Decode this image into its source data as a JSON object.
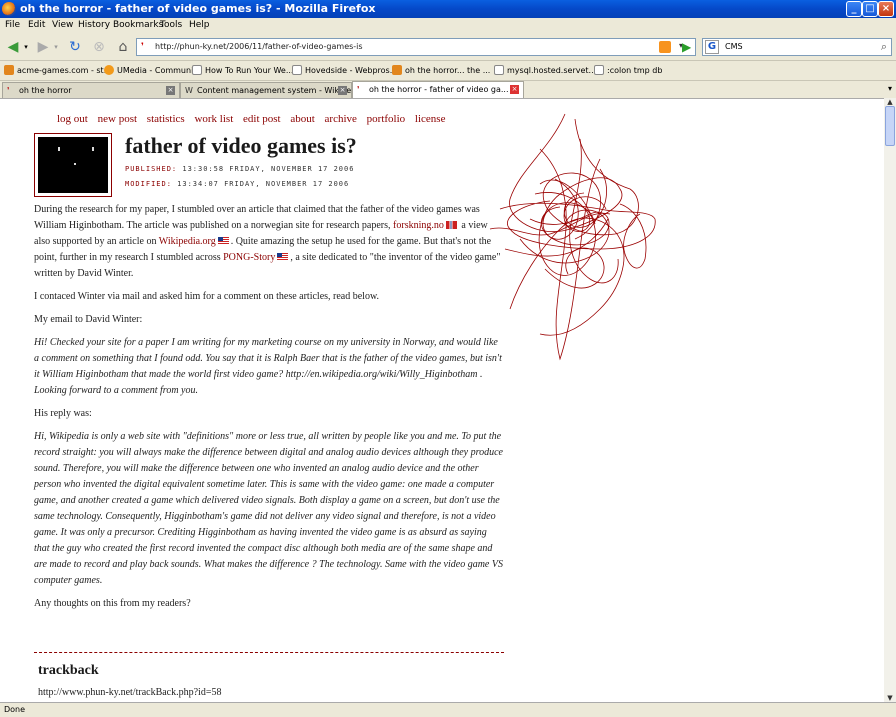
{
  "window": {
    "title": "oh the horror - father of video games is? - Mozilla Firefox"
  },
  "menu": [
    "File",
    "Edit",
    "View",
    "History",
    "Bookmarks",
    "Tools",
    "Help"
  ],
  "navbar": {
    "url": "http://phun-ky.net/2006/11/father-of-video-games-is",
    "search_value": "CMS"
  },
  "bookmarks": [
    {
      "label": "acme-games.com - st..."
    },
    {
      "label": "UMedia - Community"
    },
    {
      "label": "How To Run Your We..."
    },
    {
      "label": "Hovedside - Webpros..."
    },
    {
      "label": "oh the horror... the ..."
    },
    {
      "label": "mysql.hosted.servet..."
    },
    {
      "label": ":colon tmp db"
    }
  ],
  "tabs": [
    {
      "label": "oh the horror"
    },
    {
      "label": "Content management system - Wikipe..."
    },
    {
      "label": "oh the horror - father of video ga..."
    }
  ],
  "page": {
    "nav": [
      "log out",
      "new post",
      "statistics",
      "work list",
      "edit post",
      "about",
      "archive",
      "portfolio",
      "license"
    ],
    "title": "father of video games is?",
    "published_label": "PUBLISHED:",
    "published_value": "13:30:58 FRIDAY, NOVEMBER 17 2006",
    "modified_label": "MODIFIED:",
    "modified_value": "13:34:07 FRIDAY, NOVEMBER 17 2006",
    "p1_a": "During the research for my paper, I stumbled over an article that claimed that the father of the video games was William Higinbotham. The article was published on a norwegian site for research papers,",
    "p1_link1": "forskning.no",
    "p1_b": "a view also supported by an article on",
    "p1_link2": "Wikipedia.org",
    "p1_c": ". Quite amazing the setup he used for the game. But that's not the point, further in my research I stumbled across",
    "p1_link3": "PONG-Story",
    "p1_d": ", a site dedicated to \"the inventor of the video game\" written by David Winter.",
    "p2": "I contaced Winter via mail and asked him for a comment on these articles, read below.",
    "p3": "My email to David Winter:",
    "p4": "Hi! Checked your site for a paper I am writing for my marketing course on my university in Norway, and would like a comment on something that I found odd. You say that it is Ralph Baer that is the father of the video games, but isn't it William Higinbotham that made the world first video game? http://en.wikipedia.org/wiki/Willy_Higinbotham . Looking forward to a comment from you.",
    "p5": "His reply was:",
    "p6": "Hi, Wikipedia is only a web site with \"definitions\" more or less true, all written by people like you and me. To put the record straight: you will always make the difference between digital and analog audio devices although they produce sound. Therefore, you will make the difference between one who invented an analog audio device and the other person who invented the digital equivalent sometime later. This is same with the video game: one made a computer game, and another created a game which delivered video signals. Both display a game on a screen, but don't use the same technology. Consequently, Higginbotham's game did not deliver any video signal and therefore, is not a video game. It was only a precursor. Crediting Higginbotham as having invented the video game is as absurd as saying that the guy who created the first record invented the compact disc although both media are of the same shape and are made to record and play back sounds. What makes the difference ? The technology. Same with the video game VS computer games.",
    "p7": "Any thoughts on this from my readers?",
    "trackback_title": "trackback",
    "trackback_url": "http://www.phun-ky.net/trackBack.php?id=58"
  },
  "status": "Done",
  "colors": {
    "accent": "#8b0000",
    "titlebar": "#0548c8",
    "scribble": "#9a0000"
  }
}
